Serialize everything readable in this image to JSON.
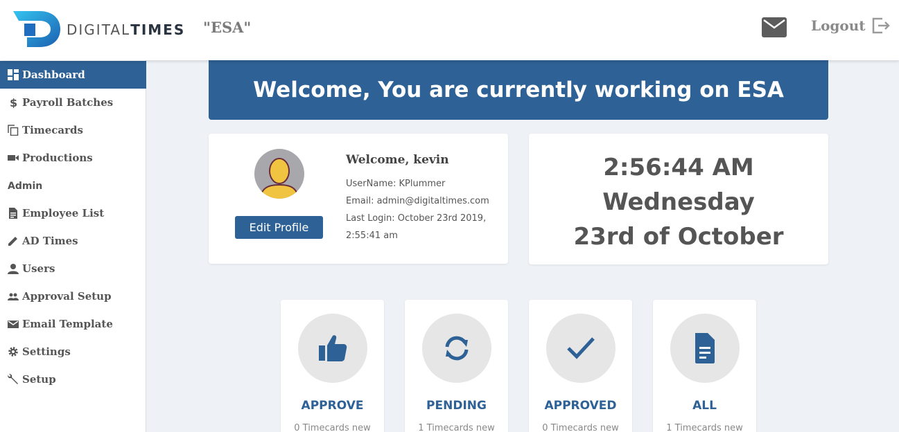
{
  "header": {
    "brand_light": "DIGITAL",
    "brand_bold": "TIMES",
    "org": "\"ESA\"",
    "logout_label": "Logout"
  },
  "sidebar": {
    "items": [
      {
        "label": "Dashboard",
        "icon": "dashboard-icon"
      },
      {
        "label": "Payroll Batches",
        "icon": "dollar-icon"
      },
      {
        "label": "Timecards",
        "icon": "copy-icon"
      },
      {
        "label": "Productions",
        "icon": "video-camera-icon"
      },
      {
        "label": "Employee List",
        "icon": "document-icon"
      },
      {
        "label": "AD Times",
        "icon": "pencil-icon"
      },
      {
        "label": "Users",
        "icon": "user-icon"
      },
      {
        "label": "Approval Setup",
        "icon": "people-icon"
      },
      {
        "label": "Email Template",
        "icon": "envelope-icon"
      },
      {
        "label": "Settings",
        "icon": "gear-icon"
      },
      {
        "label": "Setup",
        "icon": "wrench-icon"
      }
    ],
    "admin_heading": "Admin"
  },
  "banner": {
    "text": "Welcome, You are currently working on ESA"
  },
  "profile": {
    "welcome": "Welcome, kevin",
    "username": "UserName: KPlummer",
    "email": "Email: admin@digitaltimes.com",
    "last_login_1": "Last Login: October 23rd 2019,",
    "last_login_2": "2:55:41 am",
    "edit_label": "Edit Profile"
  },
  "clock": {
    "time": "2:56:44 AM",
    "day": "Wednesday",
    "date": "23rd of October"
  },
  "stats": [
    {
      "title": "APPROVE",
      "sub": "0 Timecards new",
      "icon": "thumbs-up-icon"
    },
    {
      "title": "PENDING",
      "sub": "1 Timecards new",
      "icon": "sync-icon"
    },
    {
      "title": "APPROVED",
      "sub": "0 Timecards new",
      "icon": "checkmark-icon"
    },
    {
      "title": "ALL",
      "sub": "1 Timecards new",
      "icon": "file-icon"
    }
  ],
  "colors": {
    "primary": "#2e6195",
    "background": "#eef2f6"
  }
}
